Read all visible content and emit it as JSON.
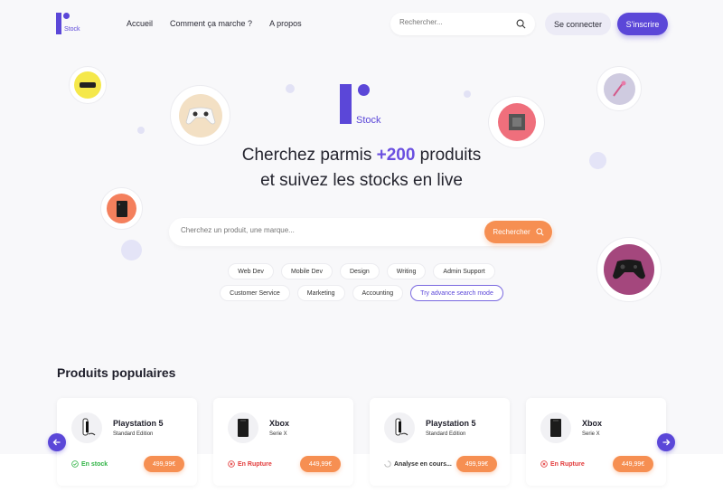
{
  "nav": {
    "logo_text": "Stock",
    "links": [
      "Accueil",
      "Comment ça marche ?",
      "A propos"
    ],
    "search_placeholder": "Rechercher...",
    "login_label": "Se connecter",
    "signup_label": "S'inscrire"
  },
  "hero": {
    "logo_text": "Stock",
    "title_part1": "Cherchez parmis ",
    "title_accent": "+200",
    "title_part2": " produits",
    "title_line2": "et suivez les stocks en live",
    "search_placeholder": "Cherchez un produit, une marque...",
    "search_button": "Rechercher",
    "tags_row1": [
      "Web Dev",
      "Mobile Dev",
      "Design",
      "Writing",
      "Admin Support"
    ],
    "tags_row2": [
      "Customer Service",
      "Marketing",
      "Accounting"
    ],
    "advanced_label": "Try advance search mode"
  },
  "popular": {
    "title": "Produits populaires",
    "products": [
      {
        "name": "Playstation 5",
        "subtitle": "Standard Edition",
        "status": "En stock",
        "status_type": "in-stock",
        "price": "499,99€",
        "thumb": "ps5"
      },
      {
        "name": "Xbox",
        "subtitle": "Serie X",
        "status": "En Rupture",
        "status_type": "out-of-stock",
        "price": "449,99€",
        "thumb": "xbox"
      },
      {
        "name": "Playstation 5",
        "subtitle": "Standard Edition",
        "status": "Analyse en cours...",
        "status_type": "analyzing",
        "price": "499,99€",
        "thumb": "ps5"
      },
      {
        "name": "Xbox",
        "subtitle": "Serie X",
        "status": "En Rupture",
        "status_type": "out-of-stock",
        "price": "449,99€",
        "thumb": "xbox"
      }
    ]
  },
  "colors": {
    "primary": "#5b47d8",
    "accent": "#f68f52",
    "in_stock": "#2fb344",
    "out_of_stock": "#e23a3a"
  }
}
